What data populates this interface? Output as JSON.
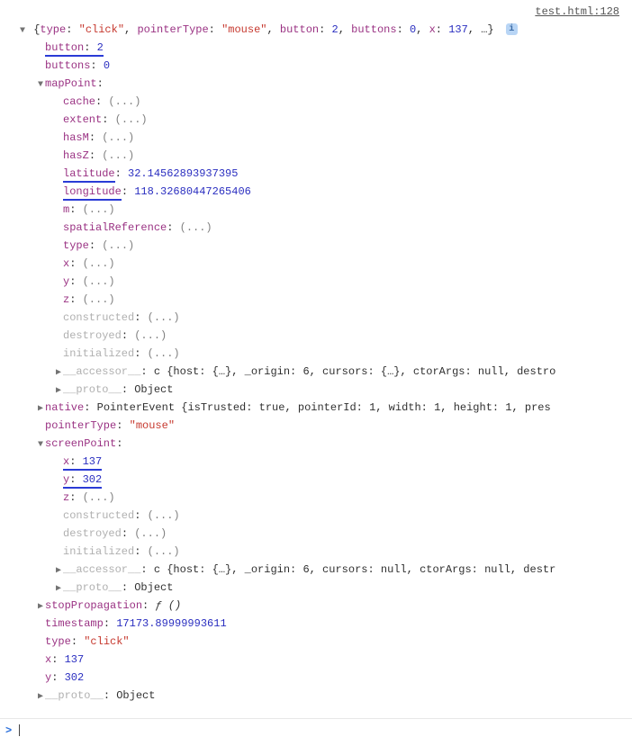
{
  "source": {
    "file": "test.html",
    "line": "128"
  },
  "summary": {
    "pairs": [
      {
        "k": "type",
        "v": "\"click\"",
        "cls": "val-str"
      },
      {
        "k": "pointerType",
        "v": "\"mouse\"",
        "cls": "val-str"
      },
      {
        "k": "button",
        "v": "2",
        "cls": "val-num"
      },
      {
        "k": "buttons",
        "v": "0",
        "cls": "val-num"
      },
      {
        "k": "x",
        "v": "137",
        "cls": "val-num"
      }
    ],
    "tail": ", …}"
  },
  "obj": {
    "button": "2",
    "buttons": "0",
    "mapPoint_label": "mapPoint",
    "mapPoint": {
      "cache": "(...)",
      "extent": "(...)",
      "hasM": "(...)",
      "hasZ": "(...)",
      "latitude": "32.14562893937395",
      "longitude": "118.32680447265406",
      "m": "(...)",
      "spatialReference": "(...)",
      "type": "(...)",
      "x": "(...)",
      "y": "(...)",
      "z": "(...)",
      "constructed": "(...)",
      "destroyed": "(...)",
      "initialized": "(...)",
      "accessor_label": "__accessor__",
      "accessor_preview": "c {host: {…}, _origin: 6, cursors: {…}, ctorArgs: null, destro",
      "proto_label": "__proto__",
      "proto_preview": "Object"
    },
    "native_label": "native",
    "native_preview": "PointerEvent {isTrusted: true, pointerId: 1, width: 1, height: 1, pres",
    "pointerType": "\"mouse\"",
    "screenPoint_label": "screenPoint",
    "screenPoint": {
      "x": "137",
      "y": "302",
      "z": "(...)",
      "constructed": "(...)",
      "destroyed": "(...)",
      "initialized": "(...)",
      "accessor_label": "__accessor__",
      "accessor_preview": "c {host: {…}, _origin: 6, cursors: null, ctorArgs: null, destr",
      "proto_label": "__proto__",
      "proto_preview": "Object"
    },
    "stopPropagation_label": "stopPropagation",
    "stopPropagation_val": "ƒ ()",
    "timestamp": "17173.89999993611",
    "type": "\"click\"",
    "x": "137",
    "y": "302",
    "proto_label": "__proto__",
    "proto_preview": "Object"
  },
  "prompt": ">"
}
